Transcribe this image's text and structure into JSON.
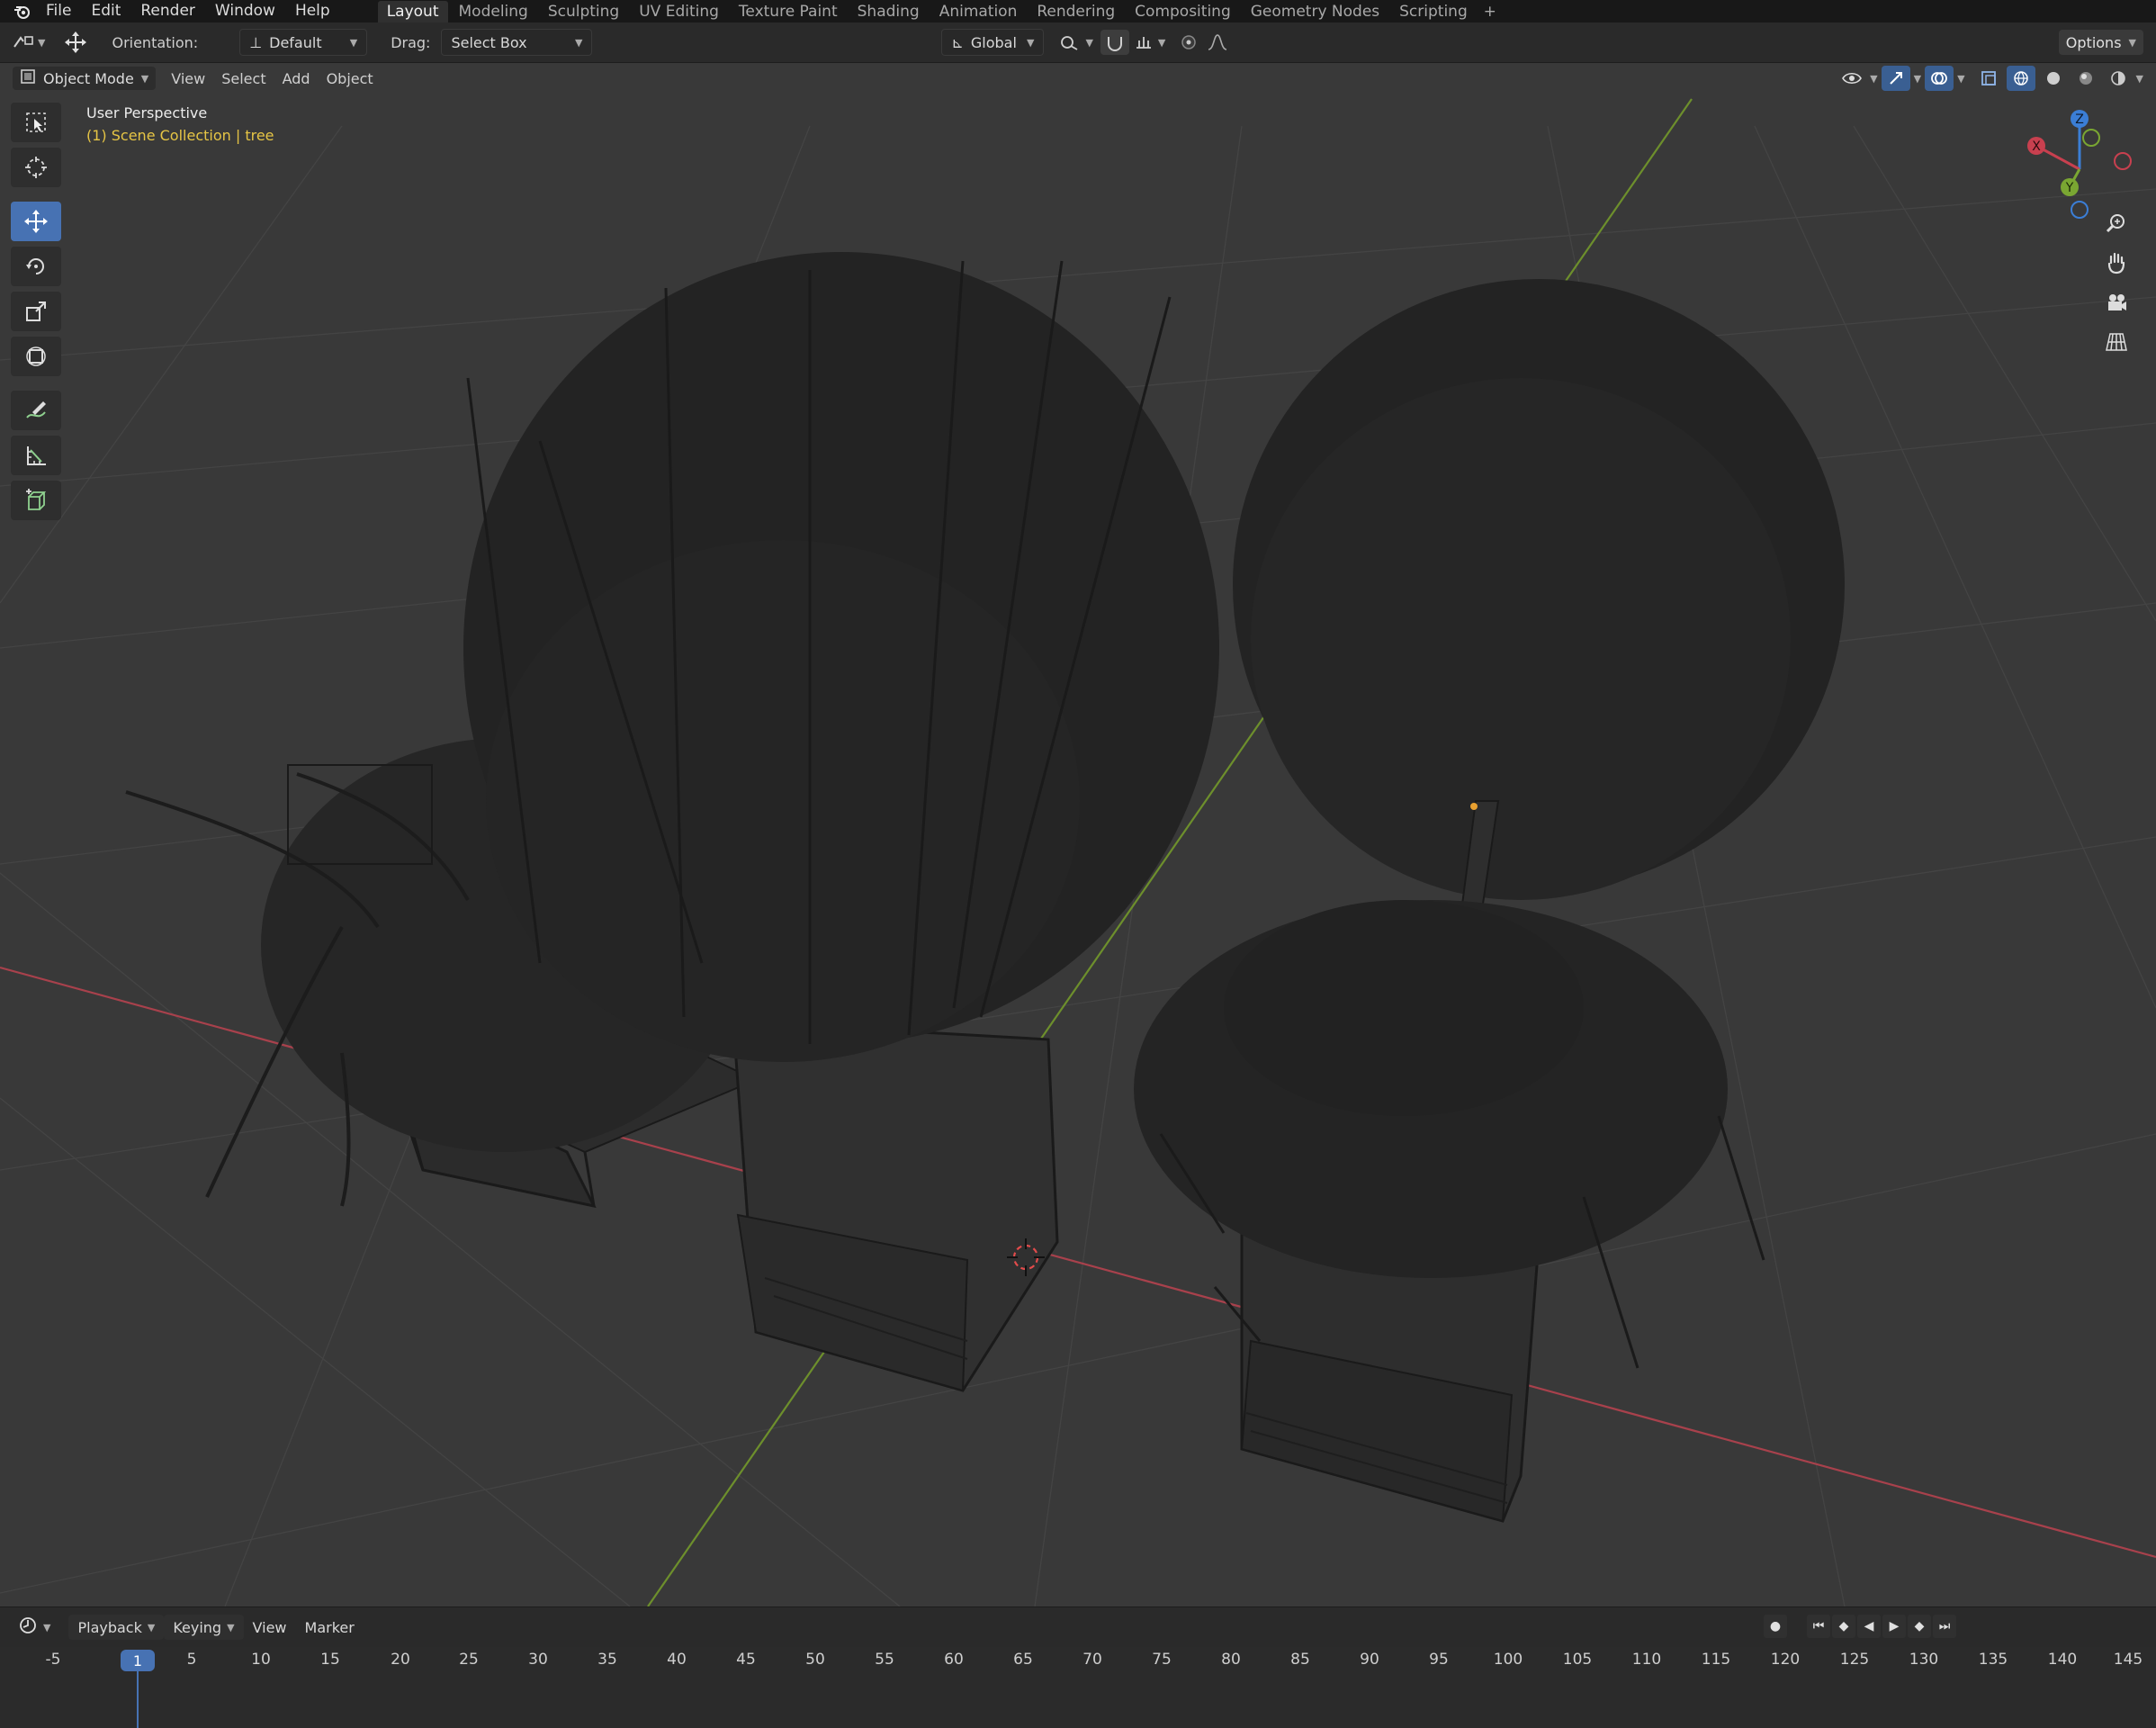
{
  "menubar": {
    "items": [
      "File",
      "Edit",
      "Render",
      "Window",
      "Help"
    ],
    "workspaces": [
      "Layout",
      "Modeling",
      "Sculpting",
      "UV Editing",
      "Texture Paint",
      "Shading",
      "Animation",
      "Rendering",
      "Compositing",
      "Geometry Nodes",
      "Scripting"
    ],
    "active_workspace": "Layout",
    "add_tab": "+"
  },
  "toolheader": {
    "orientation_label": "Orientation:",
    "orientation_value": "Default",
    "drag_label": "Drag:",
    "drag_value": "Select Box",
    "transform_space": "Global",
    "options_label": "Options"
  },
  "viewport": {
    "mode": "Object Mode",
    "menus": [
      "View",
      "Select",
      "Add",
      "Object"
    ],
    "overlay_title": "User Perspective",
    "overlay_collection": "(1) Scene Collection | tree",
    "gizmo_axes": {
      "x": "X",
      "y": "Y",
      "z": "Z"
    },
    "colors": {
      "x_axis": "#c8404f",
      "y_axis": "#7aa632",
      "z_axis": "#3b7ed6",
      "background": "#393939",
      "selected": "#e6c545"
    }
  },
  "toolbar": {
    "tools": [
      "select-box-icon",
      "cursor-icon",
      "move-icon",
      "rotate-icon",
      "scale-icon",
      "transform-icon",
      "annotate-icon",
      "measure-icon",
      "add-cube-icon"
    ],
    "active_tool": "move-icon"
  },
  "timeline": {
    "menus": [
      "Playback",
      "Keying",
      "View",
      "Marker"
    ],
    "current_frame": "1",
    "ticks": [
      "-5",
      "5",
      "10",
      "15",
      "20",
      "25",
      "30",
      "35",
      "40",
      "45",
      "50",
      "55",
      "60",
      "65",
      "70",
      "75",
      "80",
      "85",
      "90",
      "95",
      "100",
      "105",
      "110",
      "115",
      "120",
      "125",
      "130",
      "135",
      "140",
      "145"
    ]
  }
}
